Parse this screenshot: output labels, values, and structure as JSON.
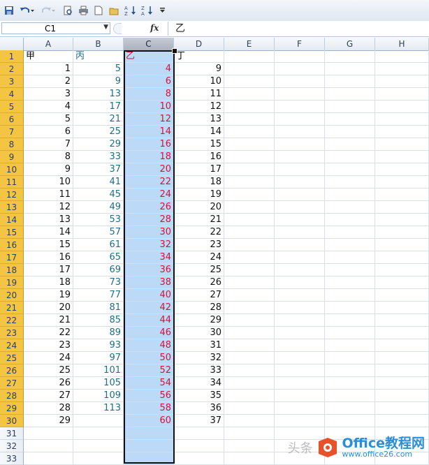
{
  "formula_bar": {
    "name_box": "C1",
    "fx_label": "fx",
    "content": "乙"
  },
  "columns": [
    "A",
    "B",
    "C",
    "D",
    "E",
    "F",
    "G",
    "H"
  ],
  "selected_column": "C",
  "active_cell": "C1",
  "rows": [
    {
      "n": "1",
      "A": "甲",
      "B": "丙",
      "C": "乙",
      "D": "丁"
    },
    {
      "n": "2",
      "A": "1",
      "B": "5",
      "C": "4",
      "D": "9"
    },
    {
      "n": "3",
      "A": "2",
      "B": "9",
      "C": "6",
      "D": "10"
    },
    {
      "n": "4",
      "A": "3",
      "B": "13",
      "C": "8",
      "D": "11"
    },
    {
      "n": "5",
      "A": "4",
      "B": "17",
      "C": "10",
      "D": "12"
    },
    {
      "n": "6",
      "A": "5",
      "B": "21",
      "C": "12",
      "D": "13"
    },
    {
      "n": "7",
      "A": "6",
      "B": "25",
      "C": "14",
      "D": "14"
    },
    {
      "n": "8",
      "A": "7",
      "B": "29",
      "C": "16",
      "D": "15"
    },
    {
      "n": "9",
      "A": "8",
      "B": "33",
      "C": "18",
      "D": "16"
    },
    {
      "n": "10",
      "A": "9",
      "B": "37",
      "C": "20",
      "D": "17"
    },
    {
      "n": "11",
      "A": "10",
      "B": "41",
      "C": "22",
      "D": "18"
    },
    {
      "n": "12",
      "A": "11",
      "B": "45",
      "C": "24",
      "D": "19"
    },
    {
      "n": "13",
      "A": "12",
      "B": "49",
      "C": "26",
      "D": "20"
    },
    {
      "n": "14",
      "A": "13",
      "B": "53",
      "C": "28",
      "D": "21"
    },
    {
      "n": "15",
      "A": "14",
      "B": "57",
      "C": "30",
      "D": "22"
    },
    {
      "n": "16",
      "A": "15",
      "B": "61",
      "C": "32",
      "D": "23"
    },
    {
      "n": "17",
      "A": "16",
      "B": "65",
      "C": "34",
      "D": "24"
    },
    {
      "n": "18",
      "A": "17",
      "B": "69",
      "C": "36",
      "D": "25"
    },
    {
      "n": "19",
      "A": "18",
      "B": "73",
      "C": "38",
      "D": "26"
    },
    {
      "n": "20",
      "A": "19",
      "B": "77",
      "C": "40",
      "D": "27"
    },
    {
      "n": "21",
      "A": "20",
      "B": "81",
      "C": "42",
      "D": "28"
    },
    {
      "n": "22",
      "A": "21",
      "B": "85",
      "C": "44",
      "D": "29"
    },
    {
      "n": "23",
      "A": "22",
      "B": "89",
      "C": "46",
      "D": "30"
    },
    {
      "n": "24",
      "A": "23",
      "B": "93",
      "C": "48",
      "D": "31"
    },
    {
      "n": "25",
      "A": "24",
      "B": "97",
      "C": "50",
      "D": "32"
    },
    {
      "n": "26",
      "A": "25",
      "B": "101",
      "C": "52",
      "D": "33"
    },
    {
      "n": "27",
      "A": "26",
      "B": "105",
      "C": "54",
      "D": "34"
    },
    {
      "n": "28",
      "A": "27",
      "B": "109",
      "C": "56",
      "D": "35"
    },
    {
      "n": "29",
      "A": "28",
      "B": "113",
      "C": "58",
      "D": "36"
    },
    {
      "n": "30",
      "A": "29",
      "B": "",
      "C": "60",
      "D": "37"
    },
    {
      "n": "31",
      "A": "",
      "B": "",
      "C": "",
      "D": ""
    },
    {
      "n": "32",
      "A": "",
      "B": "",
      "C": "",
      "D": ""
    },
    {
      "n": "33",
      "A": "",
      "B": "",
      "C": "",
      "D": ""
    }
  ],
  "highlight_rows": 30,
  "colors": {
    "col_B_text": "#1d6f86",
    "col_C_text": "#d0143a",
    "selection_fill": "#bcd9f7",
    "row_header_highlight": "#f4c542"
  },
  "watermark": {
    "left_text": "头条",
    "brand": "Office教程网",
    "url": "www.office26.com"
  }
}
